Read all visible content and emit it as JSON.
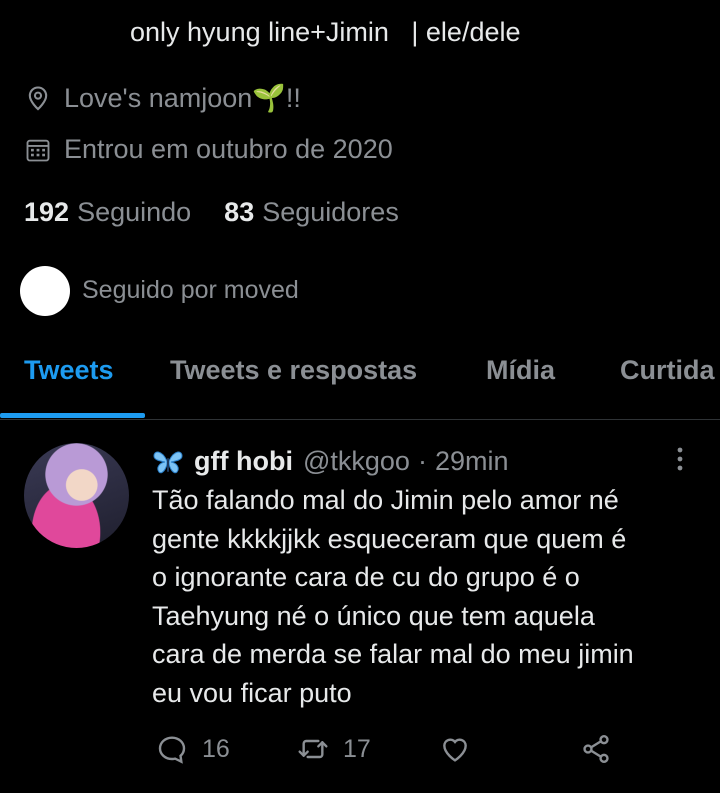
{
  "profile": {
    "bio": "only hyung line+Jimin   | ele/dele",
    "location": "Love's namjoon🌱!!",
    "joined": "Entrou em outubro de 2020",
    "following_count": "192",
    "following_label": "Seguindo",
    "followers_count": "83",
    "followers_label": "Seguidores",
    "followed_by": "Seguido por moved"
  },
  "tabs": [
    {
      "label": "Tweets",
      "active": true
    },
    {
      "label": "Tweets e respostas",
      "active": false
    },
    {
      "label": "Mídia",
      "active": false
    },
    {
      "label": "Curtida",
      "active": false
    }
  ],
  "tweet": {
    "name": "gff hobi",
    "handle": "@tkkgoo",
    "separator": "·",
    "time": "29min",
    "lines": [
      "Tão falando mal do Jimin pelo amor né",
      "gente kkkkjjkk esqueceram que quem é",
      "o ignorante cara de cu do grupo é o",
      "Taehyung né o único que tem aquela",
      "cara de merda se falar mal do meu jimin",
      "eu vou ficar puto"
    ],
    "reply_count": "16",
    "retweet_count": "17"
  },
  "icons": {
    "location": "location-pin-icon",
    "calendar": "calendar-icon",
    "butterfly": "butterfly-emoji-icon",
    "more": "more-vertical-icon",
    "reply": "reply-icon",
    "retweet": "retweet-icon",
    "like": "heart-icon",
    "share": "share-icon"
  },
  "colors": {
    "background": "#000000",
    "accent": "#1d9bf0",
    "text_primary": "#e7e9ea",
    "text_secondary": "#8b8f94",
    "divider": "#2f3336"
  }
}
